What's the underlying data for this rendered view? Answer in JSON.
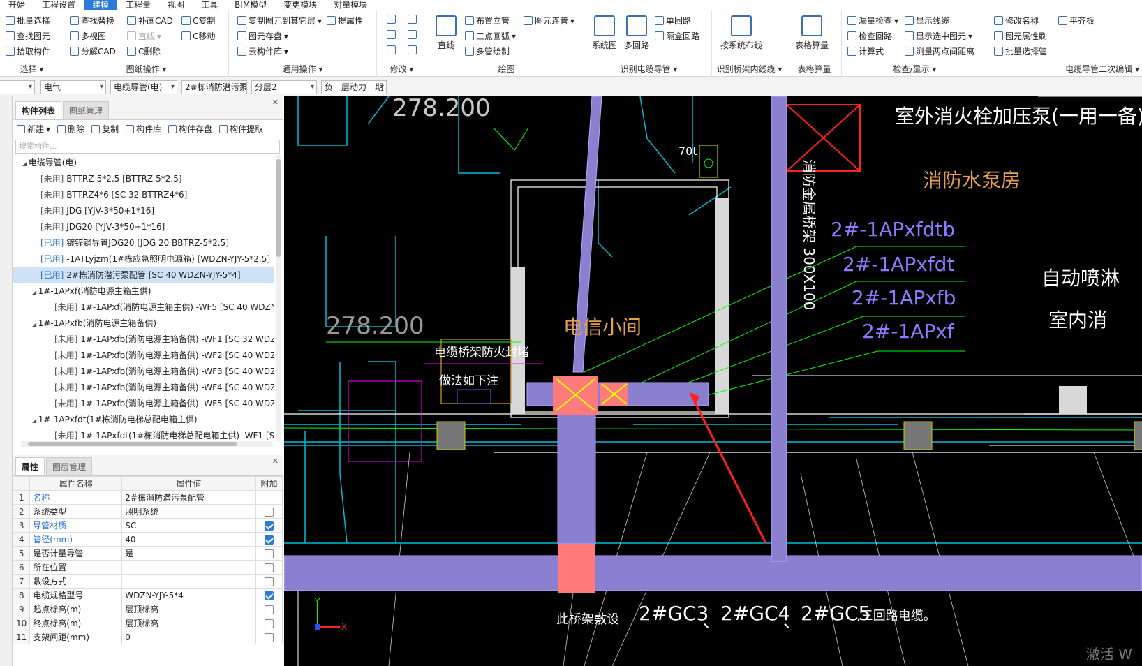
{
  "menu": {
    "tabs": [
      "开始",
      "工程设置",
      "建模",
      "工程量",
      "视图",
      "工具",
      "BIM模型",
      "变更模块",
      "对量模块"
    ]
  },
  "ribbon": {
    "select": {
      "caption": "选择",
      "items": [
        "批量选择",
        "查找图元",
        "拾取构件"
      ]
    },
    "drawing": {
      "caption": "图纸操作",
      "items": [
        "查找替换",
        "多视图",
        "分解CAD",
        "补画CAD",
        "直线",
        "C删除",
        "C复制",
        "C移动"
      ]
    },
    "general": {
      "caption": "通用操作",
      "items": [
        "复制图元到其它层",
        "图元存盘",
        "云构件库",
        "提属性"
      ]
    },
    "modify": {
      "caption": "修改"
    },
    "draw": {
      "caption": "绘图",
      "items": [
        "直线",
        "布置立管",
        "三点画弧",
        "多管绘制",
        "图元连管"
      ]
    },
    "cable": {
      "caption": "识别电缆导管",
      "items": [
        "系统图",
        "多回路",
        "单回路",
        "隔盒回路"
      ]
    },
    "tray": {
      "caption": "识别桥架内线缆",
      "items": [
        "按系统布线"
      ]
    },
    "table": {
      "caption": "表格算量",
      "items": [
        "表格算量"
      ]
    },
    "check": {
      "caption": "检查/显示",
      "items": [
        "漏量检查",
        "检查回路",
        "计算式",
        "显示线缆",
        "显示选中图元",
        "测量两点间距离"
      ]
    },
    "edit2": {
      "caption": "电缆导管二次编辑",
      "items": [
        "修改名称",
        "图元属性刷",
        "批量选择管",
        "平齐板"
      ]
    }
  },
  "filters": {
    "f0": "",
    "f1": "电气",
    "f2": "电缆导管(电)",
    "f3": "2#栋消防潜污泵",
    "f4": "分层2",
    "f5": "负一层动力一期"
  },
  "panel": {
    "tabs": [
      "构件列表",
      "图纸管理"
    ],
    "toolbar": [
      "新建",
      "删除",
      "复制",
      "构件库",
      "构件存盘",
      "构件提取"
    ],
    "search_placeholder": "搜索构件...",
    "tree": [
      {
        "tag": "",
        "text": "电缆导管(电)",
        "level": 0,
        "exp": true
      },
      {
        "tag": "[未用]",
        "text": "BTTRZ-5*2.5 [BTTRZ-5*2.5]",
        "level": 2
      },
      {
        "tag": "[未用]",
        "text": "BTTRZ4*6 [SC 32 BTTRZ4*6]",
        "level": 2
      },
      {
        "tag": "[未用]",
        "text": "JDG [YJV-3*50+1*16]",
        "level": 2
      },
      {
        "tag": "[未用]",
        "text": "JDG20 [YJV-3*50+1*16]",
        "level": 2
      },
      {
        "tag": "[已用]",
        "text": "镀锌钢导管JDG20 [JDG 20 BBTRZ-5*2.5]",
        "level": 2,
        "used": true
      },
      {
        "tag": "[已用]",
        "text": "-1ATLyjzm(1#栋应急照明电源箱)   [WDZN-YJY-5*2.5]",
        "level": 2,
        "used": true
      },
      {
        "tag": "[已用]",
        "text": "2#栋消防潜污泵配管 [SC 40 WDZN-YJY-5*4]",
        "level": 2,
        "used": true,
        "selected": true
      },
      {
        "tag": "",
        "text": "1#-1APxf(消防电源主箱主供)",
        "level": 1,
        "exp": true
      },
      {
        "tag": "[未用]",
        "text": "1#-1APxf(消防电源主箱主供)  -WF5 [SC 40 WDZN-YJY",
        "level": 3
      },
      {
        "tag": "",
        "text": "1#-1APxfb(消防电源主箱备供)",
        "level": 1,
        "exp": true
      },
      {
        "tag": "[未用]",
        "text": "1#-1APxfb(消防电源主箱备供)  -WF1 [SC 32 WDZN",
        "level": 3
      },
      {
        "tag": "[未用]",
        "text": "1#-1APxfb(消防电源主箱备供)  -WF2 [SC 40 WDZN",
        "level": 3
      },
      {
        "tag": "[未用]",
        "text": "1#-1APxfb(消防电源主箱备供)  -WF3 [SC 40 WDZN",
        "level": 3
      },
      {
        "tag": "[未用]",
        "text": "1#-1APxfb(消防电源主箱备供)  -WF4 [SC 40 WDZN",
        "level": 3
      },
      {
        "tag": "[未用]",
        "text": "1#-1APxfb(消防电源主箱备供)  -WF5 [SC 40 WDZN",
        "level": 3
      },
      {
        "tag": "",
        "text": "1#-1APxfdt(1#栋消防电梯总配电箱主供)",
        "level": 1,
        "exp": true
      },
      {
        "tag": "[未用]",
        "text": "1#-1APxfdt(1#栋消防电梯总配电箱主供)  -WF1 [SC",
        "level": 3
      }
    ]
  },
  "props": {
    "tabs": [
      "属性",
      "图层管理"
    ],
    "headers": [
      "属性名称",
      "属性值",
      "附加"
    ],
    "rows": [
      {
        "n": "1",
        "name": "名称",
        "value": "2#栋消防潜污泵配管",
        "blue": true,
        "cb": null
      },
      {
        "n": "2",
        "name": "系统类型",
        "value": "照明系统",
        "blue": false,
        "cb": false
      },
      {
        "n": "3",
        "name": "导管材质",
        "value": "SC",
        "blue": true,
        "cb": true
      },
      {
        "n": "4",
        "name": "管径(mm)",
        "value": "40",
        "blue": true,
        "cb": true
      },
      {
        "n": "5",
        "name": "是否计量导管",
        "value": "是",
        "blue": false,
        "cb": false
      },
      {
        "n": "6",
        "name": "所在位置",
        "value": "",
        "blue": false,
        "cb": false
      },
      {
        "n": "7",
        "name": "敷设方式",
        "value": "",
        "blue": false,
        "cb": false
      },
      {
        "n": "8",
        "name": "电缆规格型号",
        "value": "WDZN-YJY-5*4",
        "blue": false,
        "cb": true
      },
      {
        "n": "9",
        "name": "起点标高(m)",
        "value": "层顶标高",
        "blue": false,
        "cb": false
      },
      {
        "n": "10",
        "name": "终点标高(m)",
        "value": "层顶标高",
        "blue": false,
        "cb": false
      },
      {
        "n": "11",
        "name": "支架间距(mm)",
        "value": "0",
        "blue": false,
        "cb": false
      }
    ]
  },
  "canvas": {
    "texts": {
      "elev1": "278.200",
      "elev2": "278.200",
      "pump": "室外消火栓加压泵(一用一备)",
      "room": "消防水泵房",
      "tele": "电信小间",
      "seal1": "电缆桥架防火封堵",
      "seal2": "做法如下注",
      "tray": "消防金属桥架 300X100",
      "l1": "2#-1APxfdtb",
      "l2": "2#-1APxfdt",
      "l3": "2#-1APxfb",
      "l4": "2#-1APxf",
      "r1": "自动喷淋",
      "r2": "室内消",
      "n70": "70t",
      "bottom1": "此桥架敷设",
      "gc3": "2#GC3",
      "gc4": "2#GC4",
      "gc5": "2#GC5",
      "dot1": "、",
      "dot2": "、",
      "three": ",三回路电缆。",
      "wm": "激活 W",
      "ax_y": "Y",
      "ax_x": "X"
    }
  }
}
